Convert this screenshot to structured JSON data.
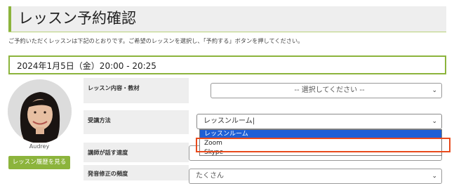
{
  "page": {
    "title": "レッスン予約確認",
    "intro": "ご予約いただくレッスンは下記のとおりです。ご希望のレッスンを選択し、「予約する」ボタンを押してください。",
    "date_time": "2024年1月5日（金）20:00 - 20:25"
  },
  "teacher": {
    "name": "Audrey",
    "history_button": "レッスン履歴を見る"
  },
  "form": {
    "lesson": {
      "label": "レッスン内容・教材",
      "value": "-- 選択してください --"
    },
    "method": {
      "label": "受講方法",
      "value": "レッスンルーム",
      "options": [
        "レッスンルーム",
        "Zoom",
        "Skype"
      ],
      "highlighted_option": "Zoom"
    },
    "speed": {
      "label": "講師が話す速度",
      "value": ""
    },
    "pronunciation": {
      "label": "発音修正の頻度",
      "value": "たくさん"
    }
  },
  "colors": {
    "accent": "#8cb43c",
    "dropdown_selected": "#1e5fd6",
    "highlight": "#e84a1c"
  },
  "icons": {
    "select_arrow": "chevron-down-icon"
  }
}
